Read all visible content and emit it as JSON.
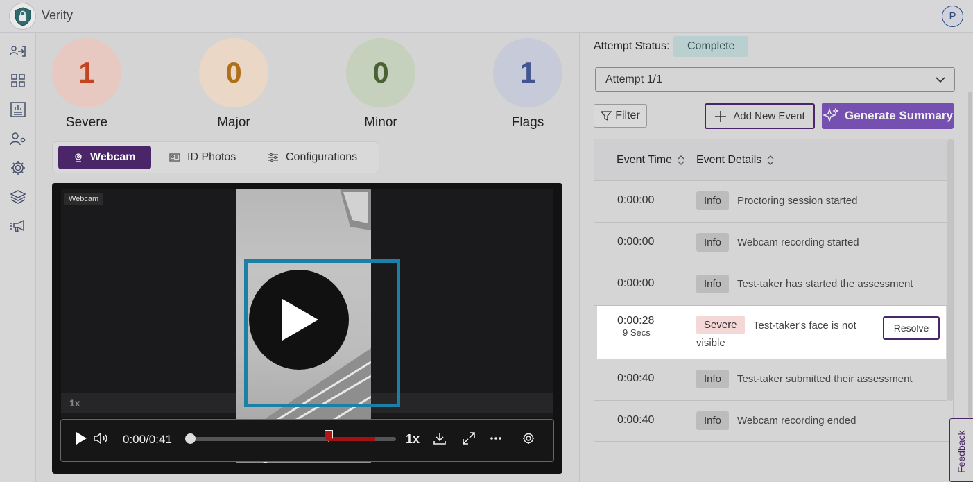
{
  "app": {
    "name": "Verity",
    "user_initial": "P"
  },
  "sidebar": {
    "items": [
      {
        "icon": "login-icon"
      },
      {
        "icon": "grid-icon"
      },
      {
        "icon": "report-icon"
      },
      {
        "icon": "user-settings-icon"
      },
      {
        "icon": "gear-icon"
      },
      {
        "icon": "layers-icon"
      },
      {
        "icon": "megaphone-icon"
      }
    ]
  },
  "stats": [
    {
      "value": "1",
      "label": "Severe",
      "color": "#c2451f",
      "bg": "#e8c9c1"
    },
    {
      "value": "0",
      "label": "Major",
      "color": "#b0701a",
      "bg": "#ead7c5"
    },
    {
      "value": "0",
      "label": "Minor",
      "color": "#4a6233",
      "bg": "#c5d0bd"
    },
    {
      "value": "1",
      "label": "Flags",
      "color": "#42558f",
      "bg": "#c6cad9"
    }
  ],
  "tabs": [
    "Webcam",
    "ID Photos",
    "Configurations"
  ],
  "player": {
    "badge": "Webcam",
    "speed_overlay": "1x",
    "time": "0:00/0:41",
    "speed": "1x"
  },
  "panel": {
    "attempt_status_label": "Attempt Status:",
    "attempt_status_value": "Complete",
    "attempt_select": "Attempt 1/1",
    "filter_label": "Filter",
    "add_event_label": "Add New Event",
    "generate_label": "Generate Summary"
  },
  "table": {
    "headers": [
      "Event Time",
      "Event Details"
    ],
    "rows": [
      {
        "time": "0:00:00",
        "type": "Info",
        "text": "Proctoring session started"
      },
      {
        "time": "0:00:00",
        "type": "Info",
        "text": "Webcam recording started"
      },
      {
        "time": "0:00:00",
        "type": "Info",
        "text": "Test-taker has started the assessment"
      },
      {
        "time": "0:00:28",
        "duration": "9 Secs",
        "type": "Severe",
        "text": "Test-taker's face is not visible",
        "action": "Resolve"
      },
      {
        "time": "0:00:40",
        "type": "Info",
        "text": "Test-taker submitted their assessment"
      },
      {
        "time": "0:00:40",
        "type": "Info",
        "text": "Webcam recording ended"
      }
    ]
  },
  "feedback": "Feedback"
}
